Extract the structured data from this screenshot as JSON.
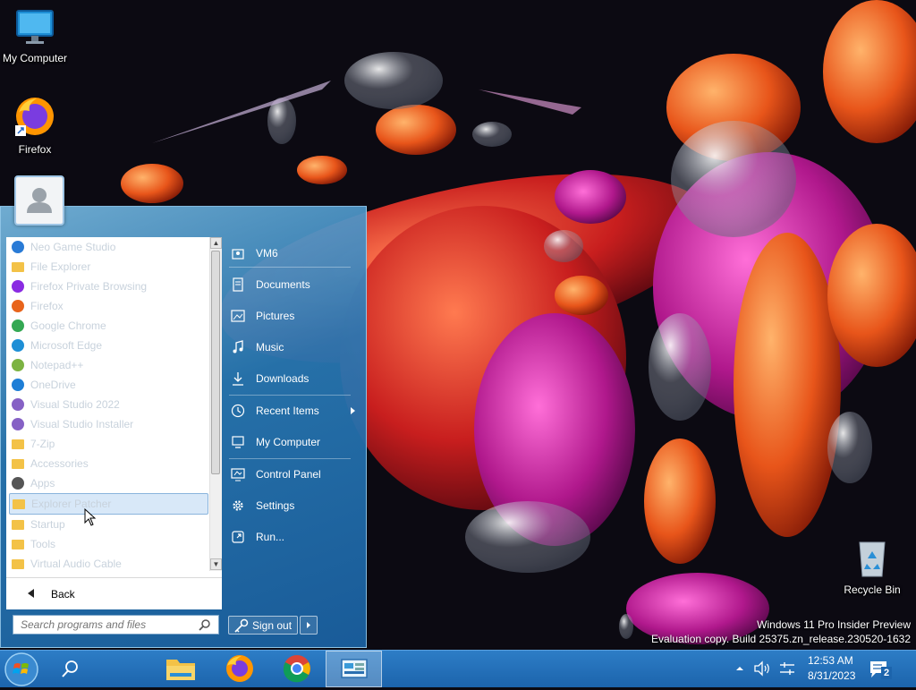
{
  "desktop": {
    "icons": [
      {
        "label": "My Computer"
      },
      {
        "label": "Firefox"
      },
      {
        "label": "Recycle Bin"
      }
    ],
    "watermark": {
      "line1": "Windows 11 Pro Insider Preview",
      "line2": "Evaluation copy. Build 25375.zn_release.230520-1632"
    }
  },
  "start_menu": {
    "programs": [
      {
        "label": "Neo Game Studio",
        "icon": "app-icon",
        "color": "#2a7bd6"
      },
      {
        "label": "File Explorer",
        "icon": "folder-icon",
        "color": "#f3c247"
      },
      {
        "label": "Firefox Private Browsing",
        "icon": "firefox-private-icon",
        "color": "#8a2be2"
      },
      {
        "label": "Firefox",
        "icon": "firefox-icon",
        "color": "#e8641b"
      },
      {
        "label": "Google Chrome",
        "icon": "chrome-icon",
        "color": "#34a853"
      },
      {
        "label": "Microsoft Edge",
        "icon": "edge-icon",
        "color": "#1e8fd6"
      },
      {
        "label": "Notepad++",
        "icon": "notepad-icon",
        "color": "#7cb342"
      },
      {
        "label": "OneDrive",
        "icon": "onedrive-icon",
        "color": "#1e7ed6"
      },
      {
        "label": "Visual Studio 2022",
        "icon": "visual-studio-icon",
        "color": "#8661c5"
      },
      {
        "label": "Visual Studio Installer",
        "icon": "vs-installer-icon",
        "color": "#8661c5"
      },
      {
        "label": "7-Zip",
        "icon": "folder-icon",
        "color": "#f3c247"
      },
      {
        "label": "Accessories",
        "icon": "folder-icon",
        "color": "#f3c247"
      },
      {
        "label": "Apps",
        "icon": "apps-icon",
        "color": "#555555"
      },
      {
        "label": "Explorer Patcher",
        "icon": "folder-icon",
        "color": "#f3c247",
        "selected": true
      },
      {
        "label": "Startup",
        "icon": "folder-icon",
        "color": "#f3c247"
      },
      {
        "label": "Tools",
        "icon": "folder-icon",
        "color": "#f3c247"
      },
      {
        "label": "Virtual Audio Cable",
        "icon": "folder-icon",
        "color": "#f3c247"
      }
    ],
    "back_label": "Back",
    "search_placeholder": "Search programs and files",
    "right_items": [
      {
        "label": "VM6",
        "icon": "user-folder-icon"
      },
      {
        "label": "Documents",
        "icon": "documents-icon"
      },
      {
        "label": "Pictures",
        "icon": "pictures-icon"
      },
      {
        "label": "Music",
        "icon": "music-icon"
      },
      {
        "label": "Downloads",
        "icon": "downloads-icon"
      },
      {
        "label": "Recent Items",
        "icon": "recent-items-icon"
      },
      {
        "label": "My Computer",
        "icon": "computer-icon"
      },
      {
        "label": "Control Panel",
        "icon": "control-panel-icon"
      },
      {
        "label": "Settings",
        "icon": "settings-gear-icon"
      },
      {
        "label": "Run...",
        "icon": "run-icon"
      }
    ],
    "signout_label": "Sign out"
  },
  "taskbar": {
    "time": "12:53 AM",
    "date": "8/31/2023",
    "notification_count": "2"
  }
}
